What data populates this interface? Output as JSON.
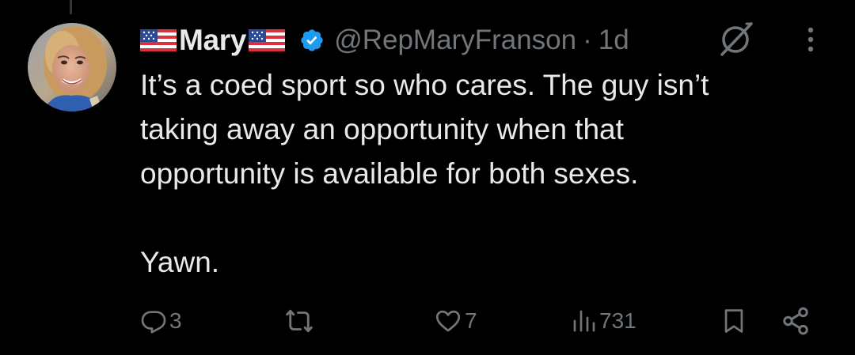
{
  "tweet": {
    "display_name": "Mary",
    "handle": "@RepMaryFranson",
    "separator": "·",
    "timestamp": "1d",
    "text": "It’s a coed sport so who cares. The guy isn’t\ntaking away an opportunity when that\nopportunity is available for both sexes.\n\nYawn.",
    "verified": true
  },
  "actions": {
    "replies": "3",
    "reposts": "",
    "likes": "7",
    "views": "731"
  },
  "icons": {
    "flag_left": "us-flag-emoji",
    "flag_right": "us-flag-emoji",
    "verified": "verified-badge-icon",
    "grok": "grok-icon",
    "more": "more-vertical-icon",
    "reply": "reply-icon",
    "repost": "repost-icon",
    "like": "heart-icon",
    "views": "views-chart-icon",
    "bookmark": "bookmark-icon",
    "share": "share-icon"
  },
  "colors": {
    "background": "#000000",
    "text_primary": "#e7e9ea",
    "text_secondary": "#71767b",
    "verified_blue": "#1d9bf0"
  }
}
